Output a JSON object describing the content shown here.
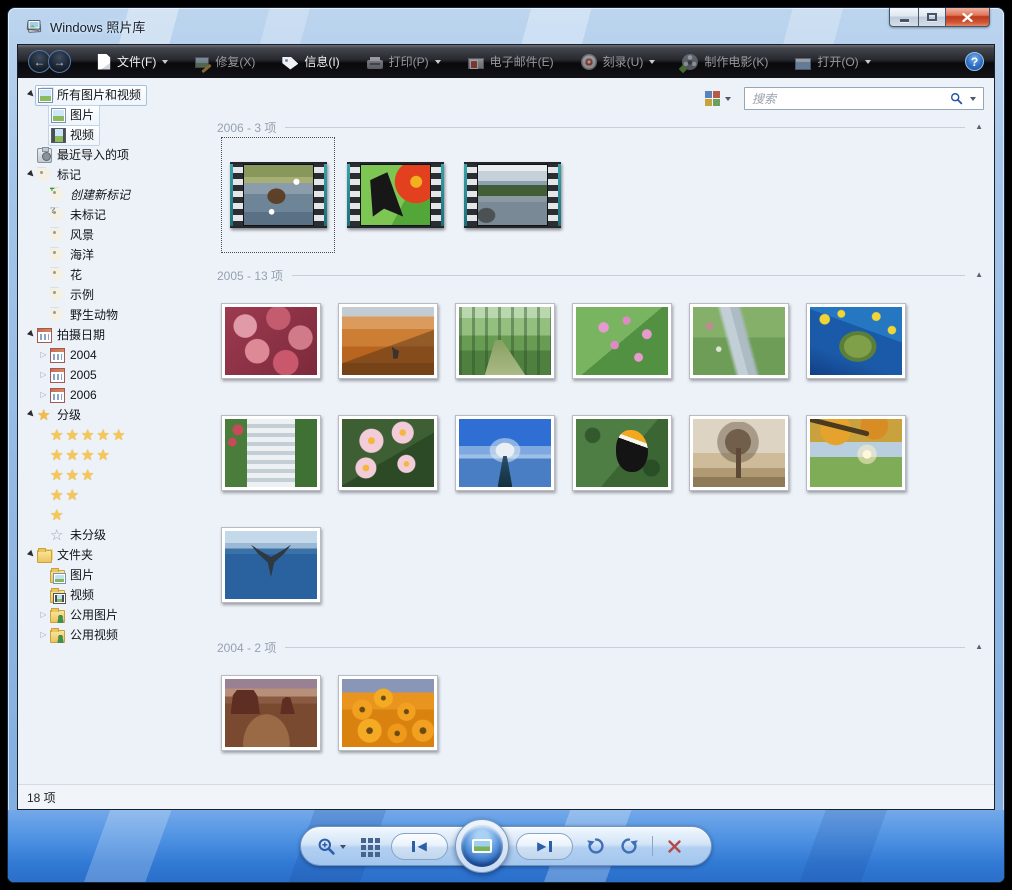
{
  "window": {
    "title": "Windows 照片库",
    "status_count": "18 项"
  },
  "colors": {
    "accent_blue": "#2b5fa8",
    "close_red": "#bc3a1d",
    "film_teal": "#2e8f96",
    "star_gold": "#fbc64e",
    "toolbar_dark": "#121217",
    "content_bg": "#edf2f9"
  },
  "toolbar": {
    "items": [
      {
        "id": "file",
        "label": "文件(F)",
        "icon": "file",
        "dropdown": true,
        "muted": false
      },
      {
        "id": "fix",
        "label": "修复(X)",
        "icon": "fix",
        "dropdown": false,
        "muted": true
      },
      {
        "id": "info",
        "label": "信息(I)",
        "icon": "info",
        "dropdown": false,
        "muted": false
      },
      {
        "id": "print",
        "label": "打印(P)",
        "icon": "print",
        "dropdown": true,
        "muted": true
      },
      {
        "id": "email",
        "label": "电子邮件(E)",
        "icon": "email",
        "dropdown": false,
        "muted": true
      },
      {
        "id": "burn",
        "label": "刻录(U)",
        "icon": "burn",
        "dropdown": true,
        "muted": true
      },
      {
        "id": "movie",
        "label": "制作电影(K)",
        "icon": "movie",
        "dropdown": false,
        "muted": true
      },
      {
        "id": "open",
        "label": "打开(O)",
        "icon": "open",
        "dropdown": true,
        "muted": true
      }
    ],
    "help_glyph": "?"
  },
  "search": {
    "placeholder": "搜索"
  },
  "sidebar": {
    "items": [
      {
        "name": "all-pictures-videos",
        "label": "所有图片和视频",
        "icon": "gallery",
        "level": 0,
        "exp": "open",
        "boxed": "active"
      },
      {
        "name": "pictures",
        "label": "图片",
        "icon": "picture",
        "level": 1,
        "exp": "none",
        "boxed": true
      },
      {
        "name": "videos",
        "label": "视频",
        "icon": "film",
        "level": 1,
        "exp": "none",
        "boxed": true
      },
      {
        "name": "recently-imported",
        "label": "最近导入的项",
        "icon": "camera",
        "level": 0,
        "exp": "none"
      },
      {
        "name": "tags",
        "label": "标记",
        "icon": "tag",
        "level": 0,
        "exp": "open"
      },
      {
        "name": "create-new-tag",
        "label": "创建新标记",
        "icon": "tag-plus",
        "level": 1,
        "exp": "none",
        "italic": true
      },
      {
        "name": "not-tagged",
        "label": "未标记",
        "icon": "tag-q",
        "level": 1,
        "exp": "none"
      },
      {
        "name": "tag-scenery",
        "label": "风景",
        "icon": "tag",
        "level": 1,
        "exp": "none"
      },
      {
        "name": "tag-ocean",
        "label": "海洋",
        "icon": "tag",
        "level": 1,
        "exp": "none"
      },
      {
        "name": "tag-flower",
        "label": "花",
        "icon": "tag",
        "level": 1,
        "exp": "none"
      },
      {
        "name": "tag-sample",
        "label": "示例",
        "icon": "tag",
        "level": 1,
        "exp": "none"
      },
      {
        "name": "tag-wildlife",
        "label": "野生动物",
        "icon": "tag",
        "level": 1,
        "exp": "none"
      },
      {
        "name": "date-taken",
        "label": "拍摄日期",
        "icon": "cal",
        "level": 0,
        "exp": "open"
      },
      {
        "name": "date-2004",
        "label": "2004",
        "icon": "cal",
        "level": 1,
        "exp": "closed"
      },
      {
        "name": "date-2005",
        "label": "2005",
        "icon": "cal",
        "level": 1,
        "exp": "closed"
      },
      {
        "name": "date-2006",
        "label": "2006",
        "icon": "cal",
        "level": 1,
        "exp": "closed"
      },
      {
        "name": "ratings",
        "label": "分级",
        "icon": "star",
        "level": 0,
        "exp": "open"
      },
      {
        "name": "rating-5",
        "stars": 5,
        "level": 1
      },
      {
        "name": "rating-4",
        "stars": 4,
        "level": 1
      },
      {
        "name": "rating-3",
        "stars": 3,
        "level": 1
      },
      {
        "name": "rating-2",
        "stars": 2,
        "level": 1
      },
      {
        "name": "rating-1",
        "stars": 1,
        "level": 1
      },
      {
        "name": "rating-none",
        "label": "未分级",
        "icon": "star-outline",
        "level": 1,
        "exp": "none"
      },
      {
        "name": "folders",
        "label": "文件夹",
        "icon": "folders",
        "level": 0,
        "exp": "open"
      },
      {
        "name": "folder-pictures",
        "label": "图片",
        "icon": "folder-pic",
        "level": 1,
        "exp": "none"
      },
      {
        "name": "folder-videos",
        "label": "视频",
        "icon": "folder-film",
        "level": 1,
        "exp": "none"
      },
      {
        "name": "folder-public-pictures",
        "label": "公用图片",
        "icon": "folder-users",
        "level": 1,
        "exp": "closed"
      },
      {
        "name": "folder-public-videos",
        "label": "公用视频",
        "icon": "folder-users",
        "level": 1,
        "exp": "closed"
      }
    ]
  },
  "groups": [
    {
      "id": "2006",
      "title": "2006 - 3 项",
      "kind": "videos",
      "items": [
        {
          "type": "video",
          "name": "bear-in-river-video",
          "visual": "v-bear",
          "selected": true
        },
        {
          "type": "video",
          "name": "butterfly-flower-video",
          "visual": "v-butterfly",
          "selected": false
        },
        {
          "type": "video",
          "name": "mountain-lake-video",
          "visual": "v-lake",
          "selected": false
        }
      ]
    },
    {
      "id": "2005",
      "title": "2005 - 13 项",
      "kind": "photos",
      "items": [
        {
          "type": "photo",
          "name": "frosted-leaves",
          "visual": "p-frosted"
        },
        {
          "type": "photo",
          "name": "desert-oryx",
          "visual": "p-desert"
        },
        {
          "type": "photo",
          "name": "forest-path",
          "visual": "p-forest"
        },
        {
          "type": "photo",
          "name": "pink-wildflowers",
          "visual": "p-pinkflowers"
        },
        {
          "type": "photo",
          "name": "meadow-stream",
          "visual": "p-stream"
        },
        {
          "type": "photo",
          "name": "sea-turtle",
          "visual": "p-turtle"
        },
        {
          "type": "photo",
          "name": "garden-waterfall",
          "visual": "p-waterfall"
        },
        {
          "type": "photo",
          "name": "plumeria-flowers",
          "visual": "p-plumeria"
        },
        {
          "type": "photo",
          "name": "ocean-pier",
          "visual": "p-pier"
        },
        {
          "type": "photo",
          "name": "toucan",
          "visual": "p-toucan"
        },
        {
          "type": "photo",
          "name": "misty-trees",
          "visual": "p-mist"
        },
        {
          "type": "photo",
          "name": "autumn-tree",
          "visual": "p-autumn"
        },
        {
          "type": "photo",
          "name": "whale-tail",
          "visual": "p-whale"
        }
      ]
    },
    {
      "id": "2004",
      "title": "2004 - 2 项",
      "kind": "photos",
      "items": [
        {
          "type": "photo",
          "name": "monument-valley",
          "visual": "p-monument"
        },
        {
          "type": "photo",
          "name": "orange-daisies",
          "visual": "p-daisies"
        }
      ]
    }
  ],
  "bottom_bar": {
    "controls": [
      "zoom",
      "thumbnail-view",
      "previous",
      "slideshow",
      "next",
      "rotate-ccw",
      "rotate-cw",
      "delete"
    ]
  }
}
